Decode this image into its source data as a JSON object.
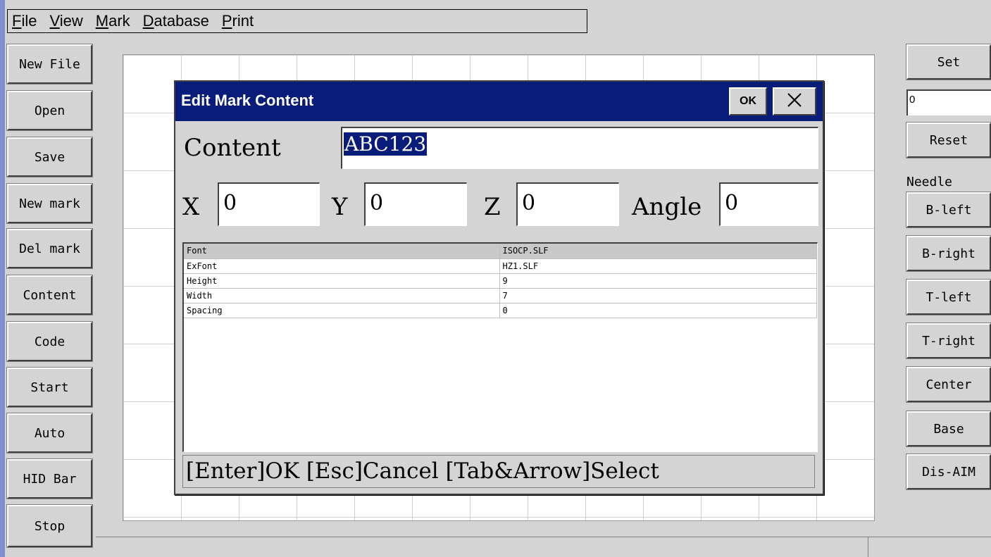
{
  "menu": {
    "items": [
      {
        "label": "File",
        "hotkey": "F",
        "rest": "ile"
      },
      {
        "label": "View",
        "hotkey": "V",
        "rest": "iew"
      },
      {
        "label": "Mark",
        "hotkey": "M",
        "rest": "ark"
      },
      {
        "label": "Database",
        "hotkey": "D",
        "rest": "atabase"
      },
      {
        "label": "Print",
        "hotkey": "P",
        "rest": "rint"
      }
    ]
  },
  "left_toolbar": {
    "new_file": "New File",
    "open": "Open",
    "save": "Save",
    "new_mark": "New mark",
    "del_mark": "Del mark",
    "content": "Content",
    "code": "Code",
    "start": "Start",
    "auto": "Auto",
    "hid_bar": "HID Bar",
    "stop": "Stop"
  },
  "right_toolbar": {
    "set": "Set",
    "set_value": "0",
    "reset": "Reset",
    "needle_label": "Needle",
    "b_left": "B-left",
    "b_right": "B-right",
    "t_left": "T-left",
    "t_right": "T-right",
    "center": "Center",
    "base": "Base",
    "dis_aim": "Dis-AIM"
  },
  "dialog": {
    "title": "Edit Mark Content",
    "ok_label": "OK",
    "content_label": "Content",
    "content_value": "ABC123",
    "x_label": "X",
    "x_value": "0",
    "y_label": "Y",
    "y_value": "0",
    "z_label": "Z",
    "z_value": "0",
    "angle_label": "Angle",
    "angle_value": "0",
    "properties": [
      {
        "key": "Font",
        "value": "ISOCP.SLF"
      },
      {
        "key": "ExFont",
        "value": "HZ1.SLF"
      },
      {
        "key": "Height",
        "value": "9"
      },
      {
        "key": "Width",
        "value": "7"
      },
      {
        "key": "Spacing",
        "value": "0"
      }
    ],
    "hint": "[Enter]OK [Esc]Cancel [Tab&Arrow]Select"
  },
  "colors": {
    "title_bar": "#0a1c7a",
    "window_bg": "#d4d4d4",
    "selection": "#0a1c7a"
  },
  "icons": {
    "close": "close-icon"
  }
}
